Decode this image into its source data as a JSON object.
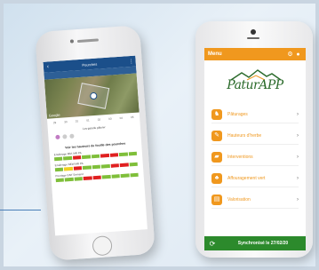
{
  "iphone": {
    "title": "Pourches",
    "days": [
      "29",
      "30",
      "31",
      "01",
      "02",
      "03",
      "04",
      "05"
    ],
    "section_label": "Les gazelle pâturer",
    "heading": "Voir les hauteurs de fouille des pourches",
    "bars": [
      {
        "label": "Ensilerage MM. MR PA",
        "cells": [
          "g",
          "g",
          "r",
          "g",
          "g",
          "r",
          "r",
          "g",
          "g"
        ]
      },
      {
        "label": "Ensilerage NEW MR PA",
        "cells": [
          "g",
          "y",
          "r",
          "g",
          "g",
          "g",
          "r",
          "r",
          "g"
        ]
      },
      {
        "label": "Pourtage GNT Enmand",
        "cells": [
          "g",
          "g",
          "g",
          "r",
          "r",
          "g",
          "g",
          "g",
          "g"
        ]
      }
    ],
    "map_brand": "Google"
  },
  "android": {
    "menu_label": "Menu",
    "brand": "PaturAPP",
    "items": [
      {
        "label": "Pâturages",
        "icon": "cow-icon"
      },
      {
        "label": "Hauteurs d'herbe",
        "icon": "ruler-icon"
      },
      {
        "label": "Interventions",
        "icon": "tractor-icon"
      },
      {
        "label": "Affouragement vert",
        "icon": "grass-icon"
      },
      {
        "label": "Valorisation",
        "icon": "chart-icon"
      }
    ],
    "sync_text": "Synchronisé le 27/02/20",
    "colors": {
      "accent": "#f0981e",
      "sync_bar": "#2c8a2c"
    }
  }
}
